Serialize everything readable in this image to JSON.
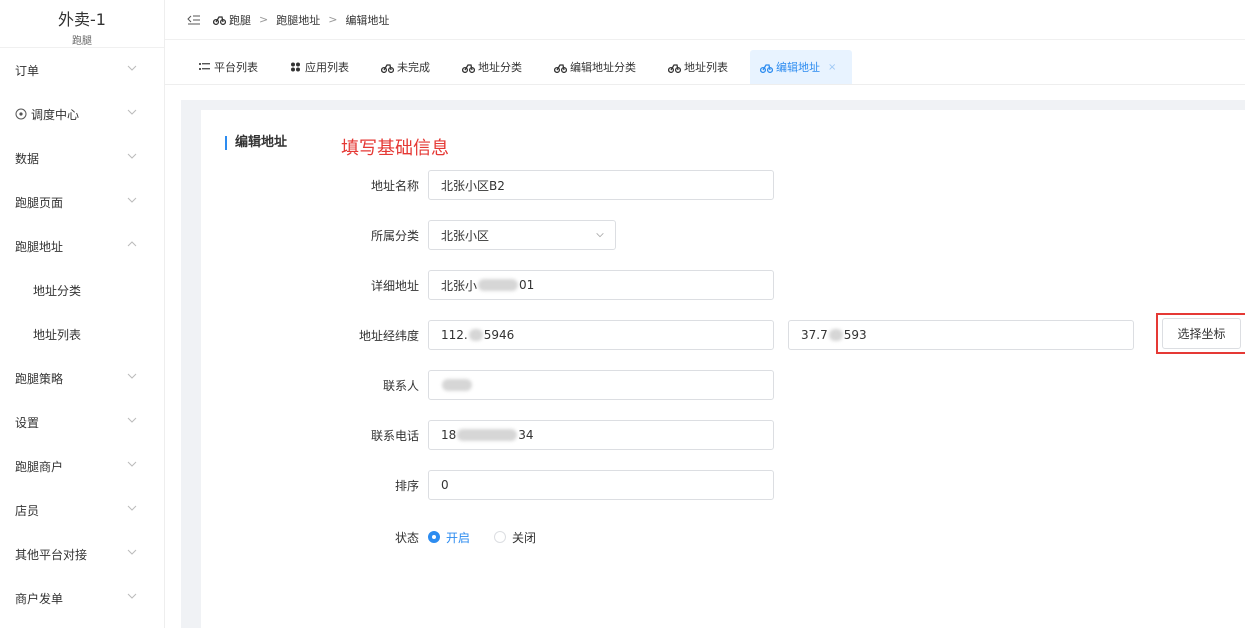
{
  "brand": {
    "title": "外卖-1",
    "subtitle": "跑腿"
  },
  "sidebar": {
    "items": [
      {
        "label": "订单"
      },
      {
        "label": "调度中心"
      },
      {
        "label": "数据"
      },
      {
        "label": "跑腿页面"
      },
      {
        "label": "跑腿地址",
        "expanded": true
      },
      {
        "label": "地址分类"
      },
      {
        "label": "地址列表"
      },
      {
        "label": "跑腿策略"
      },
      {
        "label": "设置"
      },
      {
        "label": "跑腿商户"
      },
      {
        "label": "店员"
      },
      {
        "label": "其他平台对接"
      },
      {
        "label": "商户发单"
      }
    ]
  },
  "breadcrumb": {
    "items": [
      "跑腿",
      "跑腿地址",
      "编辑地址"
    ],
    "separator": ">"
  },
  "tabs": [
    {
      "label": "平台列表",
      "icon": "list-icon"
    },
    {
      "label": "应用列表",
      "icon": "apps-icon"
    },
    {
      "label": "未完成",
      "icon": "motorbike-icon"
    },
    {
      "label": "地址分类",
      "icon": "motorbike-icon"
    },
    {
      "label": "编辑地址分类",
      "icon": "motorbike-icon"
    },
    {
      "label": "地址列表",
      "icon": "motorbike-icon"
    },
    {
      "label": "编辑地址",
      "icon": "motorbike-icon",
      "active": true,
      "close": "×"
    }
  ],
  "form": {
    "section_title": "编辑地址",
    "annotation": "填写基础信息",
    "name_label": "地址名称",
    "name_value": "北张小区B2",
    "category_label": "所属分类",
    "category_value": "北张小区",
    "detail_label": "详细地址",
    "detail_prefix": "北张小",
    "detail_suffix": "01",
    "coords_label": "地址经纬度",
    "lng_prefix": "112.",
    "lng_suffix": "5946",
    "lat_prefix": "37.7",
    "lat_suffix": "593",
    "pick_coords_label": "选择坐标",
    "contact_label": "联系人",
    "phone_label": "联系电话",
    "phone_prefix": "18",
    "phone_suffix": "34",
    "sort_label": "排序",
    "sort_value": "0",
    "status_label": "状态",
    "status_on": "开启",
    "status_off": "关闭",
    "status_selected": "开启"
  },
  "colors": {
    "accent": "#2d8cf0",
    "annotation_red": "#e53935",
    "content_bg": "#f0f2f5"
  }
}
